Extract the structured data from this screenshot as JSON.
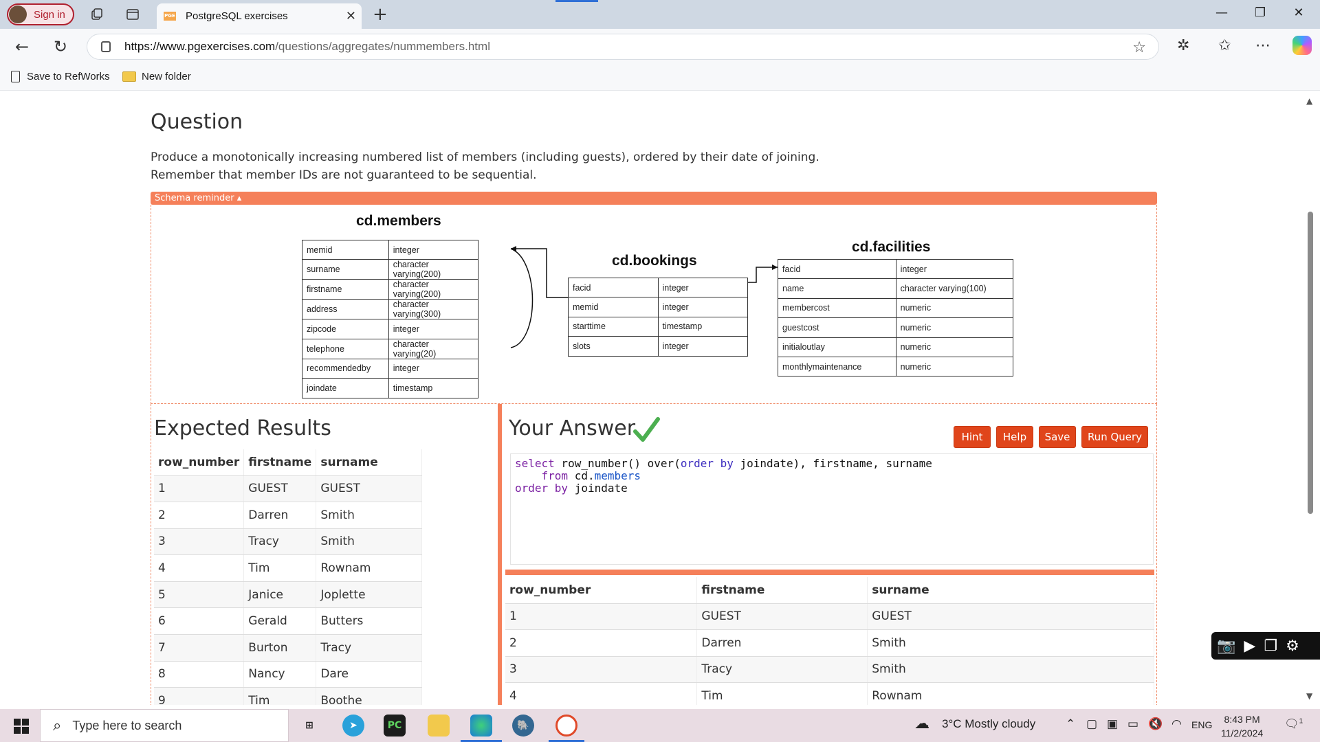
{
  "browser": {
    "signin_label": "Sign in",
    "tab_title": "PostgreSQL exercises",
    "tab_favicon_text": "PGE",
    "url_host": "https://www.pgexercises.com",
    "url_path": "/questions/aggregates/nummembers.html",
    "bookmarks": [
      "Save to RefWorks",
      "New folder"
    ]
  },
  "page": {
    "heading": "Question",
    "question_line1": "Produce a monotonically increasing numbered list of members (including guests), ordered by their date of joining.",
    "question_line2": "Remember that member IDs are not guaranteed to be sequential.",
    "schema_reminder": "Schema reminder ▴"
  },
  "schema": {
    "members": {
      "name": "cd.members",
      "rows": [
        [
          "memid",
          "integer"
        ],
        [
          "surname",
          "character varying(200)"
        ],
        [
          "firstname",
          "character varying(200)"
        ],
        [
          "address",
          "character varying(300)"
        ],
        [
          "zipcode",
          "integer"
        ],
        [
          "telephone",
          "character varying(20)"
        ],
        [
          "recommendedby",
          "integer"
        ],
        [
          "joindate",
          "timestamp"
        ]
      ]
    },
    "bookings": {
      "name": "cd.bookings",
      "rows": [
        [
          "facid",
          "integer"
        ],
        [
          "memid",
          "integer"
        ],
        [
          "starttime",
          "timestamp"
        ],
        [
          "slots",
          "integer"
        ]
      ]
    },
    "facilities": {
      "name": "cd.facilities",
      "rows": [
        [
          "facid",
          "integer"
        ],
        [
          "name",
          "character varying(100)"
        ],
        [
          "membercost",
          "numeric"
        ],
        [
          "guestcost",
          "numeric"
        ],
        [
          "initialoutlay",
          "numeric"
        ],
        [
          "monthlymaintenance",
          "numeric"
        ]
      ]
    }
  },
  "expected": {
    "heading": "Expected Results",
    "columns": [
      "row_number",
      "firstname",
      "surname"
    ],
    "rows": [
      [
        "1",
        "GUEST",
        "GUEST"
      ],
      [
        "2",
        "Darren",
        "Smith"
      ],
      [
        "3",
        "Tracy",
        "Smith"
      ],
      [
        "4",
        "Tim",
        "Rownam"
      ],
      [
        "5",
        "Janice",
        "Joplette"
      ],
      [
        "6",
        "Gerald",
        "Butters"
      ],
      [
        "7",
        "Burton",
        "Tracy"
      ],
      [
        "8",
        "Nancy",
        "Dare"
      ],
      [
        "9",
        "Tim",
        "Boothe"
      ]
    ]
  },
  "answer": {
    "heading": "Your Answer",
    "buttons": {
      "hint": "Hint",
      "help": "Help",
      "save": "Save",
      "run": "Run Query"
    },
    "query_lines": [
      "select row_number() over(order by joindate), firstname, surname",
      "    from cd.members",
      "order by joindate"
    ],
    "columns": [
      "row_number",
      "firstname",
      "surname"
    ],
    "rows": [
      [
        "1",
        "GUEST",
        "GUEST"
      ],
      [
        "2",
        "Darren",
        "Smith"
      ],
      [
        "3",
        "Tracy",
        "Smith"
      ],
      [
        "4",
        "Tim",
        "Rownam"
      ]
    ]
  },
  "taskbar": {
    "search_placeholder": "Type here to search",
    "weather": "3°C  Mostly cloudy",
    "lang": "ENG",
    "time": "8:43 PM",
    "date": "11/2/2024",
    "notif_count": "1"
  },
  "colors": {
    "accent": "#f5805a",
    "button": "#e0451b",
    "check": "#4caf50"
  }
}
